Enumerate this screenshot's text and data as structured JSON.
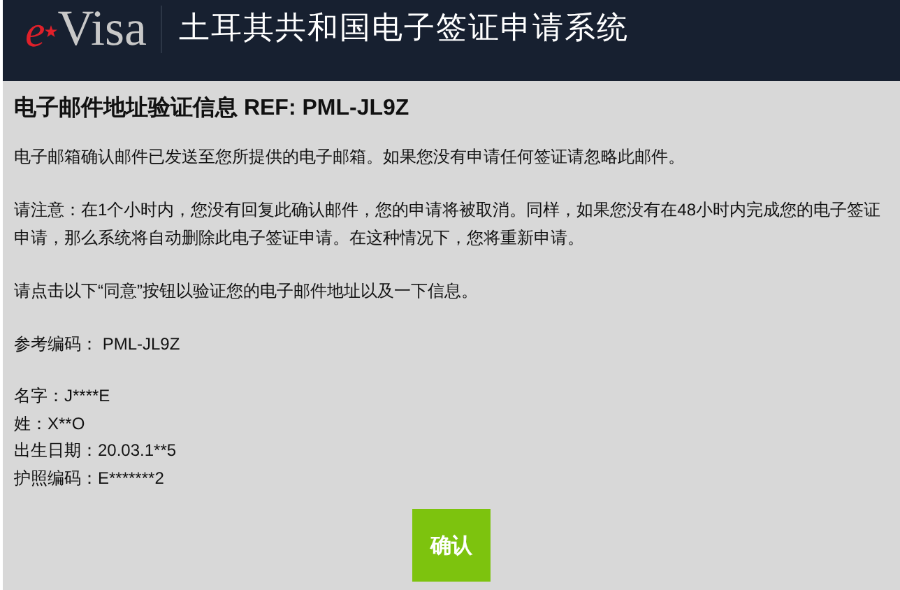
{
  "header": {
    "logo_prefix": "e",
    "logo_suffix": "Visa",
    "title": "土耳其共和国电子签证申请系统"
  },
  "heading": "电子邮件地址验证信息 REF: PML-JL9Z",
  "paragraphs": [
    "电子邮箱确认邮件已发送至您所提供的电子邮箱。如果您没有申请任何签证请忽略此邮件。",
    "请注意：在1个小时内，您没有回复此确认邮件，您的申请将被取消。同样，如果您没有在48小时内完成您的电子签证申请，那么系统将自动删除此电子签证申请。在这种情况下，您将重新申请。",
    "请点击以下“同意”按钮以验证您的电子邮件地址以及一下信息。",
    "参考编码： PML-JL9Z"
  ],
  "details": [
    "名字：J****E",
    "姓：X**O",
    "出生日期：20.03.1**5",
    "护照编码：E*******2"
  ],
  "confirm_button": "确认"
}
